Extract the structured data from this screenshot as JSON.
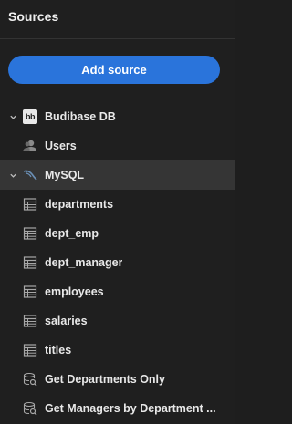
{
  "panel": {
    "title": "Sources",
    "add_source_label": "Add source"
  },
  "tree": [
    {
      "label": "Budibase DB",
      "level": 0,
      "expanded": true,
      "icon": "budibase-logo-icon",
      "selected": false
    },
    {
      "label": "Users",
      "level": 1,
      "icon": "users-icon",
      "selected": false
    },
    {
      "label": "MySQL",
      "level": 0,
      "expanded": true,
      "icon": "mysql-dolphin-icon",
      "selected": true
    },
    {
      "label": "departments",
      "level": 1,
      "icon": "table-icon",
      "selected": false
    },
    {
      "label": "dept_emp",
      "level": 1,
      "icon": "table-icon",
      "selected": false
    },
    {
      "label": "dept_manager",
      "level": 1,
      "icon": "table-icon",
      "selected": false
    },
    {
      "label": "employees",
      "level": 1,
      "icon": "table-icon",
      "selected": false
    },
    {
      "label": "salaries",
      "level": 1,
      "icon": "table-icon",
      "selected": false
    },
    {
      "label": "titles",
      "level": 1,
      "icon": "table-icon",
      "selected": false
    },
    {
      "label": "Get Departments Only",
      "level": 1,
      "icon": "query-icon",
      "selected": false
    },
    {
      "label": "Get Managers by Department ...",
      "level": 1,
      "icon": "query-icon",
      "selected": false
    }
  ],
  "colors": {
    "background": "#1f1f1f",
    "accent": "#2a74db",
    "selected_row": "#353535"
  }
}
